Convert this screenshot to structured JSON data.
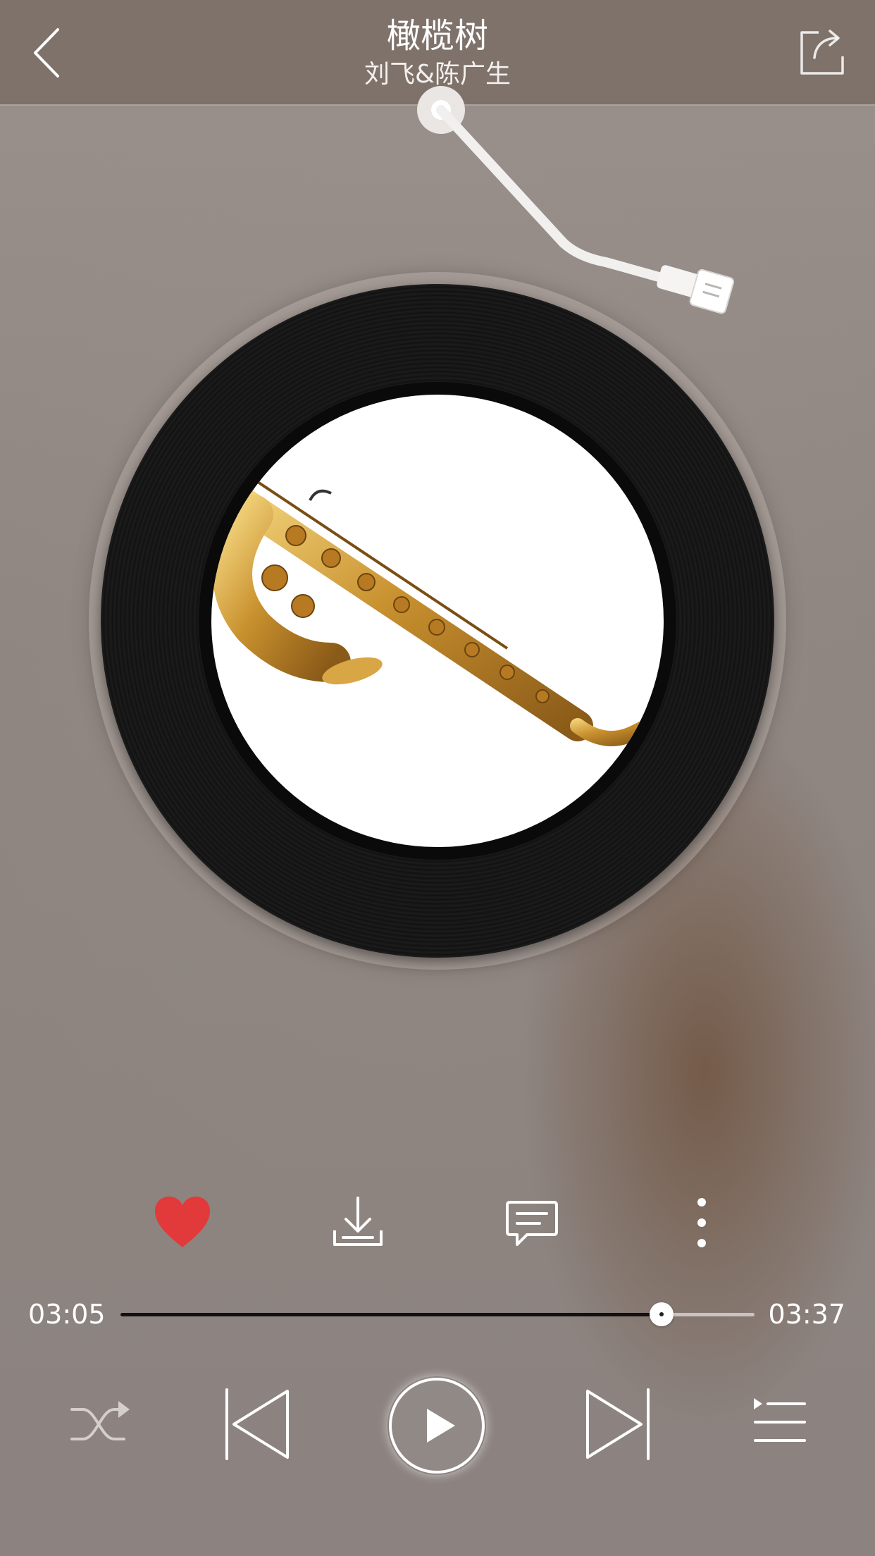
{
  "header": {
    "title": "橄榄树",
    "artist": "刘飞&陈广生",
    "back_icon": "chevron-left-icon",
    "share_icon": "share-icon"
  },
  "album": {
    "cover_subject": "saxophone",
    "disc_icon": "vinyl-record",
    "tonearm_icon": "tonearm"
  },
  "actions": [
    {
      "name": "like",
      "icon": "heart-icon",
      "active": true,
      "color": "#e23a3a"
    },
    {
      "name": "download",
      "icon": "download-icon"
    },
    {
      "name": "comment",
      "icon": "comment-icon"
    },
    {
      "name": "more",
      "icon": "more-vertical-icon"
    }
  ],
  "progress": {
    "current": "03:05",
    "total": "03:37",
    "fraction": 0.853
  },
  "controls": {
    "shuffle_icon": "shuffle-icon",
    "prev_icon": "skip-previous-icon",
    "play_icon": "play-icon",
    "next_icon": "skip-next-icon",
    "playlist_icon": "playlist-icon"
  },
  "colors": {
    "accent_like": "#e23a3a",
    "progress_played": "#111111",
    "progress_remaining": "#c9c4c1"
  }
}
